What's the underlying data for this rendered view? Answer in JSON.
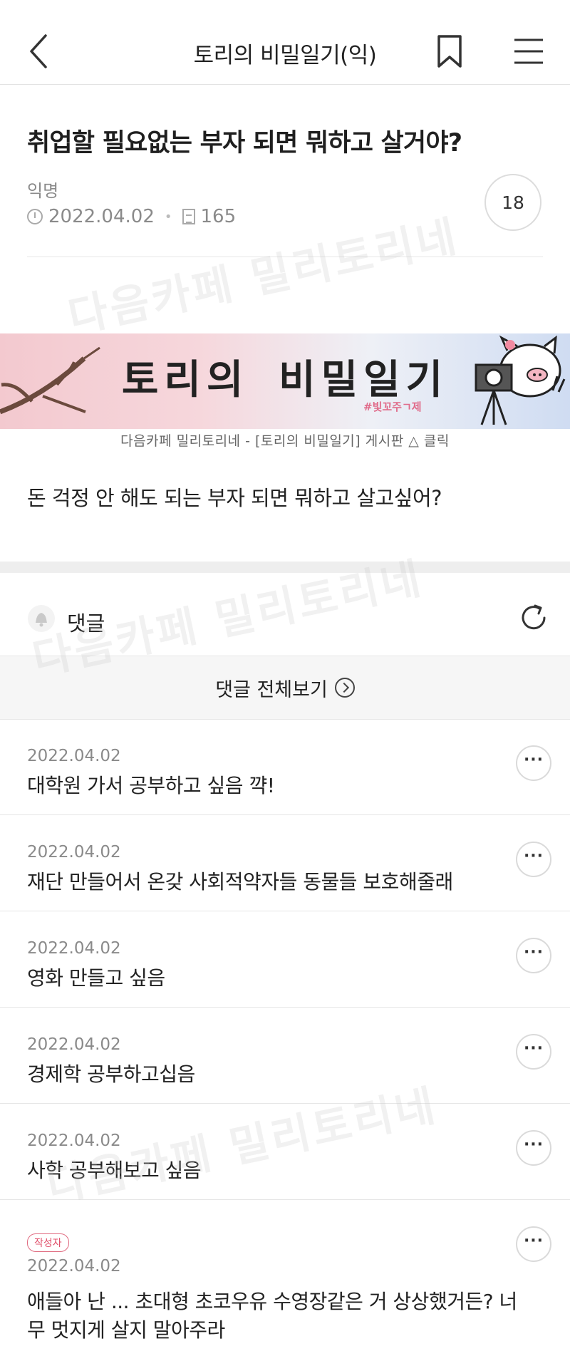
{
  "header": {
    "cafe_title": "토리의 비밀일기(익)"
  },
  "post": {
    "title": "취업할 필요없는 부자 되면 뭐하고 살거야?",
    "author": "익명",
    "date": "2022.04.02",
    "views": "165",
    "comment_count": "18",
    "banner": {
      "text": "토리의 비밀일기",
      "sub": "#빛꼬주ㄱ제",
      "caption": "다음카페 밀리토리네 - [토리의 비밀일기] 게시판 △ 클릭"
    },
    "body": "돈 걱정 안 해도 되는 부자 되면 뭐하고 살고싶어?"
  },
  "comments_section": {
    "label": "댓글",
    "view_all": "댓글 전체보기"
  },
  "comments": [
    {
      "date": "2022.04.02",
      "text": "대학원 가서 공부하고 싶음 꺅!"
    },
    {
      "date": "2022.04.02",
      "text": "재단 만들어서 온갖 사회적약자들 동물들 보호해줄래"
    },
    {
      "date": "2022.04.02",
      "text": "영화 만들고 싶음"
    },
    {
      "date": "2022.04.02",
      "text": "경제학 공부하고십음"
    },
    {
      "date": "2022.04.02",
      "text": "사학 공부해보고 싶음"
    },
    {
      "badge": "작성자",
      "date": "2022.04.02",
      "text": "애들아 난 ... 초대형 초코우유 수영장같은 거 상상했거든? 너무 멋지게 살지 말아주라"
    }
  ],
  "watermark": "다음카페 밀리토리네",
  "colors": {
    "accent_pink": "#e0506b",
    "divider": "#e6e6e6"
  },
  "icons": [
    "back-icon",
    "bookmark-icon",
    "menu-icon",
    "clock-icon",
    "views-icon",
    "bell-icon",
    "refresh-icon",
    "chevron-right-circle-icon",
    "more-icon"
  ]
}
